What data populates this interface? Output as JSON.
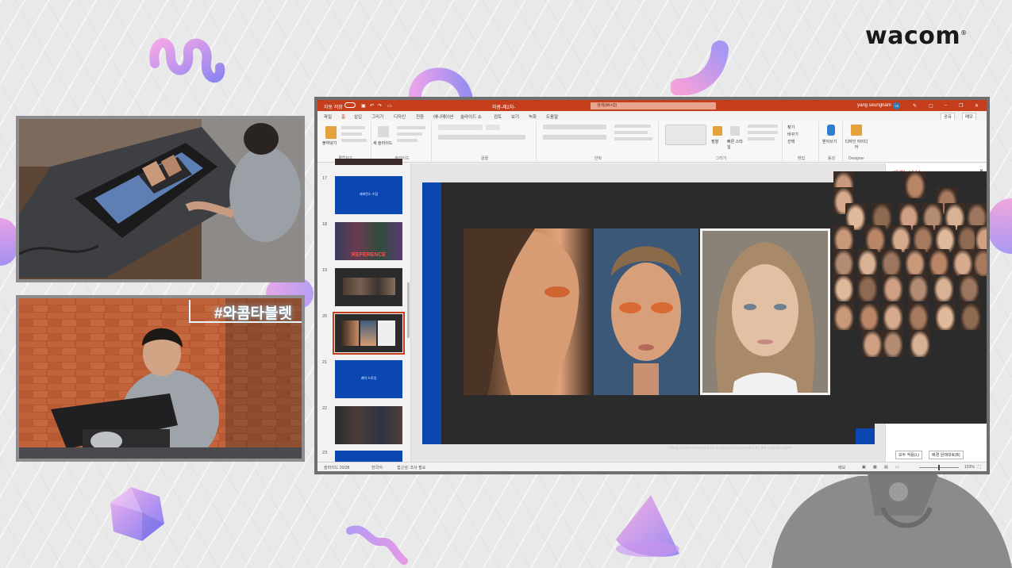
{
  "brand": {
    "logo_text": "wacom",
    "logo_mark": "®"
  },
  "overlay": {
    "hashtag": "#와콤타블렛"
  },
  "ppt": {
    "titlebar": {
      "autosave": "자동 저장",
      "filename": "와콤-제2차-",
      "search_placeholder": "검색(Alt+Q)",
      "user_name": "yang seungnam",
      "user_initials": "YS"
    },
    "tabs": [
      "파일",
      "홈",
      "삽입",
      "그리기",
      "디자인",
      "전환",
      "애니메이션",
      "슬라이드 쇼",
      "검토",
      "보기",
      "녹화",
      "도움말"
    ],
    "active_tab": "홈",
    "share_label": "공유",
    "comment_label": "메모",
    "ribbon_groups": [
      "클립보드",
      "슬라이드",
      "글꼴",
      "단락",
      "그리기",
      "편집",
      "음성",
      "Designer"
    ],
    "ribbon": {
      "paste": "붙여넣기",
      "new_slide": "새 슬라이드",
      "arrange": "정렬",
      "quick_styles": "빠른 스타일",
      "find": "찾기",
      "replace": "바꾸기",
      "select": "선택",
      "dictate": "받아쓰기",
      "designer_ideas": "디자인 아이디어"
    },
    "thumbnails": [
      {
        "num": "17",
        "text": "레퍼런스 수집",
        "selected": false
      },
      {
        "num": "18",
        "text": "REFERENCE",
        "selected": false
      },
      {
        "num": "19",
        "text": "",
        "selected": false
      },
      {
        "num": "20",
        "text": "",
        "selected": true
      },
      {
        "num": "21",
        "text": "캐릭 드로잉",
        "selected": false
      },
      {
        "num": "22",
        "text": "",
        "selected": false
      },
      {
        "num": "23",
        "text": "",
        "selected": false
      }
    ],
    "slide_caption": "Using these references for inspiration is provided by the original author",
    "background_panel": {
      "title": "배경 서식",
      "apply_all": "모두 적용(L)",
      "reset": "배경 원래대로(B)"
    },
    "statusbar": {
      "slide_count": "슬라이드 20/28",
      "language": "한국어",
      "accessibility": "접근성: 조사 필요",
      "notes": "메모",
      "zoom": "103%"
    }
  }
}
